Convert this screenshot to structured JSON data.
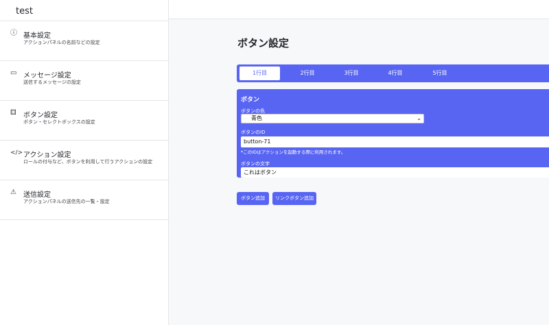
{
  "app": {
    "title": "test"
  },
  "sidebar": {
    "items": [
      {
        "icon": "info-icon",
        "glyph": "ⓘ",
        "label": "基本設定",
        "desc": "アクションパネルの名前などの設定"
      },
      {
        "icon": "message-icon",
        "glyph": "▭",
        "label": "メッセージ設定",
        "desc": "送信するメッセージの設定"
      },
      {
        "icon": "grid-icon",
        "glyph": "⚃",
        "label": "ボタン設定",
        "desc": "ボタン・セレクトボックスの設定"
      },
      {
        "icon": "code-icon",
        "glyph": "</>",
        "label": "アクション設定",
        "desc": "ロールの付与など、ボタンを利用して行うアクションの設定"
      },
      {
        "icon": "warning-icon",
        "glyph": "⚠",
        "label": "送信設定",
        "desc": "アクションパネルの送信先の一覧・設定"
      }
    ]
  },
  "main": {
    "title": "ボタン設定",
    "tabs": [
      {
        "label": "1行目"
      },
      {
        "label": "2行目"
      },
      {
        "label": "3行目"
      },
      {
        "label": "4行目"
      },
      {
        "label": "5行目"
      }
    ],
    "active_tab": 0,
    "panel": {
      "title": "ボタン",
      "color_label": "ボタンの色",
      "color_value": "青色",
      "id_label": "ボタンのID",
      "id_value": "button-71",
      "id_hint": "*このIDはアクションを起動する際に利用されます。",
      "text_label": "ボタンの文字",
      "text_value": "これはボタン"
    },
    "buttons": {
      "add_button": "ボタン追加",
      "add_link_button": "リンクボタン追加"
    }
  },
  "colors": {
    "accent": "#5865f2",
    "background": "#f7f8fa",
    "sidebar": "#ffffff"
  }
}
